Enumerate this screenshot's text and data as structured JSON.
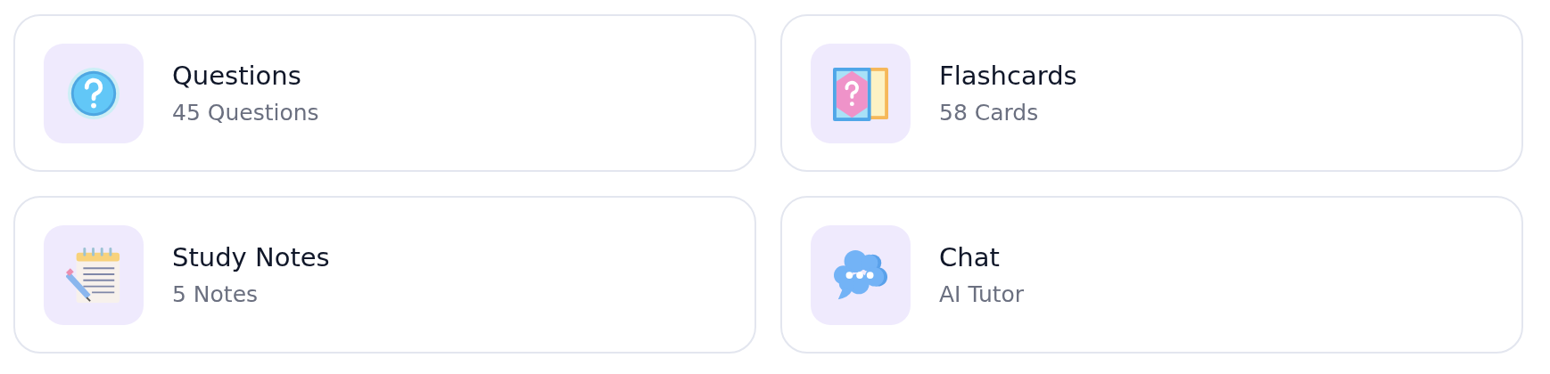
{
  "cards": [
    {
      "kind": "question",
      "title": "Questions",
      "subtitle": "45 Questions"
    },
    {
      "kind": "flashcards",
      "title": "Flashcards",
      "subtitle": "58 Cards"
    },
    {
      "kind": "notes",
      "title": "Study Notes",
      "subtitle": "5 Notes"
    },
    {
      "kind": "chat",
      "title": "Chat",
      "subtitle": "AI Tutor"
    }
  ]
}
